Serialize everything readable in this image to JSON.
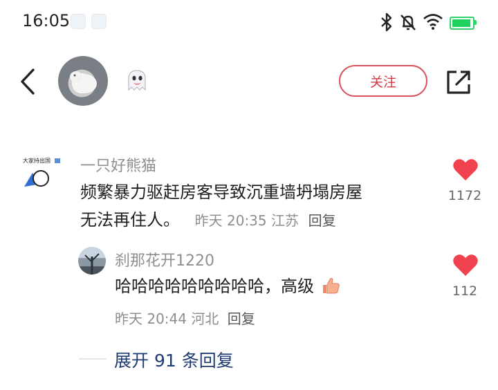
{
  "status_bar": {
    "time": "16:05",
    "icons": [
      "bluetooth-icon",
      "mute-bell-icon",
      "wifi-icon",
      "battery-icon"
    ],
    "battery_color": "#1fd15f"
  },
  "header": {
    "follow_label": "关注",
    "icons": [
      "back-arrow-icon",
      "ghost-emoji-icon",
      "share-icon"
    ]
  },
  "comment": {
    "username": "一只好熊猫",
    "text_line1": "频繁暴力驱赶房客导致沉重墙坍塌房屋",
    "text_line2": "无法再住人。",
    "meta": "昨天 20:35 江苏",
    "reply_label": "回复",
    "likes": "1172",
    "avatar_badge_text": "大家持出国"
  },
  "reply": {
    "username": "刹那花开1220",
    "text": "哈哈哈哈哈哈哈哈哈，高级",
    "meta": "昨天 20:44 河北",
    "reply_label": "回复",
    "likes": "112"
  },
  "expand_label": "展开 91 条回复",
  "colors": {
    "accent_red": "#d33b45",
    "heart_red": "#f0424f",
    "link_blue": "#1f3b73"
  }
}
